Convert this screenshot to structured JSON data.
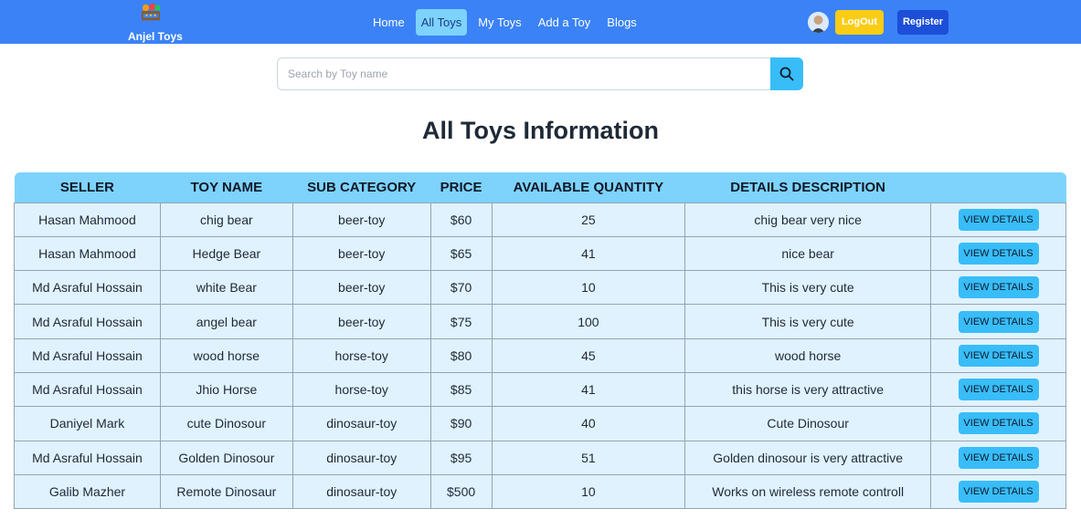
{
  "nav": {
    "brand": "Anjel Toys",
    "links": [
      "Home",
      "All Toys",
      "My Toys",
      "Add a Toy",
      "Blogs"
    ],
    "active_link": "All Toys",
    "logout_label": "LogOut",
    "register_label": "Register",
    "accent": "#3b82f6"
  },
  "search": {
    "placeholder": "Search by Toy name",
    "value": ""
  },
  "page_title": "All Toys Information",
  "table": {
    "headers": [
      "SELLER",
      "TOY NAME",
      "SUB CATEGORY",
      "PRICE",
      "AVAILABLE QUANTITY",
      "DETAILS DESCRIPTION",
      ""
    ],
    "button_label": "VIEW DETAILS",
    "rows": [
      {
        "seller": "Hasan Mahmood",
        "toy": "chig bear",
        "category": "beer-toy",
        "price": "$60",
        "qty": "25",
        "desc": "chig bear very nice"
      },
      {
        "seller": "Hasan Mahmood",
        "toy": "Hedge Bear",
        "category": "beer-toy",
        "price": "$65",
        "qty": "41",
        "desc": "nice bear"
      },
      {
        "seller": "Md Asraful Hossain",
        "toy": "white Bear",
        "category": "beer-toy",
        "price": "$70",
        "qty": "10",
        "desc": "This is very cute"
      },
      {
        "seller": "Md Asraful Hossain",
        "toy": "angel bear",
        "category": "beer-toy",
        "price": "$75",
        "qty": "100",
        "desc": "This is very cute"
      },
      {
        "seller": "Md Asraful Hossain",
        "toy": "wood horse",
        "category": "horse-toy",
        "price": "$80",
        "qty": "45",
        "desc": "wood horse"
      },
      {
        "seller": "Md Asraful Hossain",
        "toy": "Jhio Horse",
        "category": "horse-toy",
        "price": "$85",
        "qty": "41",
        "desc": "this horse is very attractive"
      },
      {
        "seller": "Daniyel Mark",
        "toy": "cute Dinosour",
        "category": "dinosaur-toy",
        "price": "$90",
        "qty": "40",
        "desc": "Cute Dinosour"
      },
      {
        "seller": "Md Asraful Hossain",
        "toy": "Golden Dinosour",
        "category": "dinosaur-toy",
        "price": "$95",
        "qty": "51",
        "desc": "Golden dinosour is very attractive"
      },
      {
        "seller": "Galib Mazher",
        "toy": "Remote Dinosaur",
        "category": "dinosaur-toy",
        "price": "$500",
        "qty": "10",
        "desc": "Works on wireless remote controll"
      }
    ]
  }
}
